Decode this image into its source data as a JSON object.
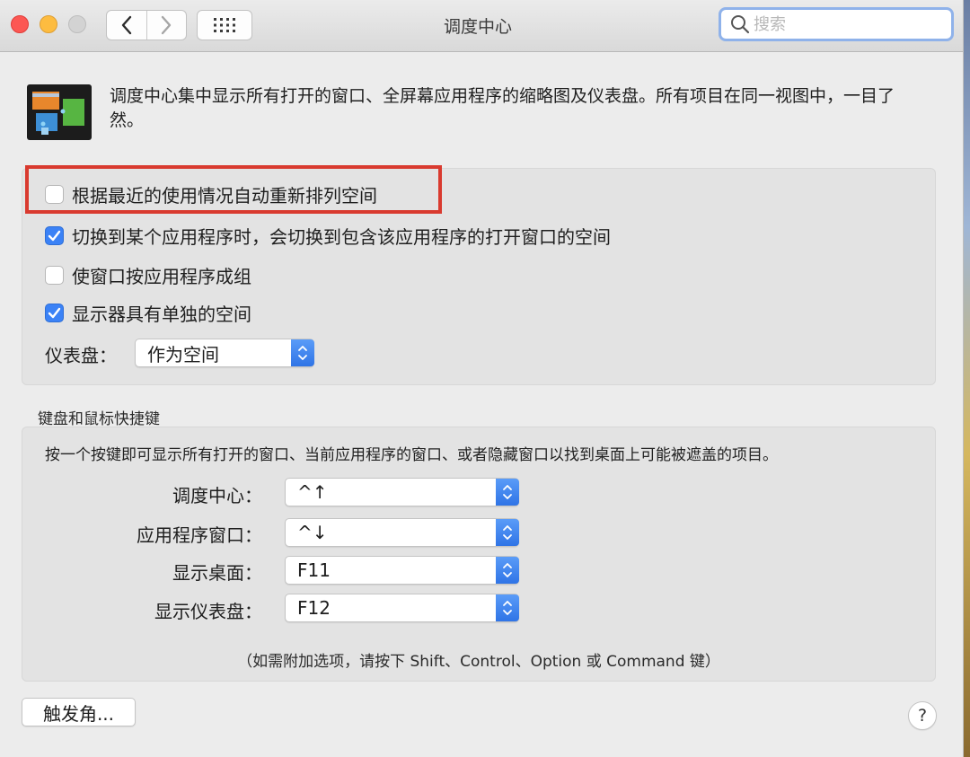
{
  "window": {
    "title": "调度中心"
  },
  "toolbar": {
    "back_icon": "chevron-left-icon",
    "forward_icon": "chevron-right-icon",
    "grid_icon": "grid-icon",
    "search_placeholder": "搜索"
  },
  "header": {
    "description": "调度中心集中显示所有打开的窗口、全屏幕应用程序的缩略图及仪表盘。所有项目在同一视图中，一目了然。"
  },
  "options": {
    "items": [
      {
        "label": "根据最近的使用情况自动重新排列空间",
        "checked": false
      },
      {
        "label": "切换到某个应用程序时，会切换到包含该应用程序的打开窗口的空间",
        "checked": true
      },
      {
        "label": "使窗口按应用程序成组",
        "checked": false
      },
      {
        "label": "显示器具有单独的空间",
        "checked": true
      }
    ],
    "dashboard_label": "仪表盘：",
    "dashboard_value": "作为空间"
  },
  "shortcuts": {
    "section_title": "键盘和鼠标快捷键",
    "description": "按一个按键即可显示所有打开的窗口、当前应用程序的窗口、或者隐藏窗口以找到桌面上可能被遮盖的项目。",
    "rows": [
      {
        "label": "调度中心：",
        "value": "^↑"
      },
      {
        "label": "应用程序窗口：",
        "value": "^↓"
      },
      {
        "label": "显示桌面：",
        "value": "F11"
      },
      {
        "label": "显示仪表盘：",
        "value": "F12"
      }
    ],
    "hint": "（如需附加选项，请按下 Shift、Control、Option 或 Command 键）"
  },
  "footer": {
    "hot_corners_label": "触发角...",
    "help_label": "?"
  },
  "colors": {
    "accent": "#3b82f6",
    "highlight": "#d93a2f",
    "close": "#fc5753",
    "minimize": "#fdbc40"
  }
}
